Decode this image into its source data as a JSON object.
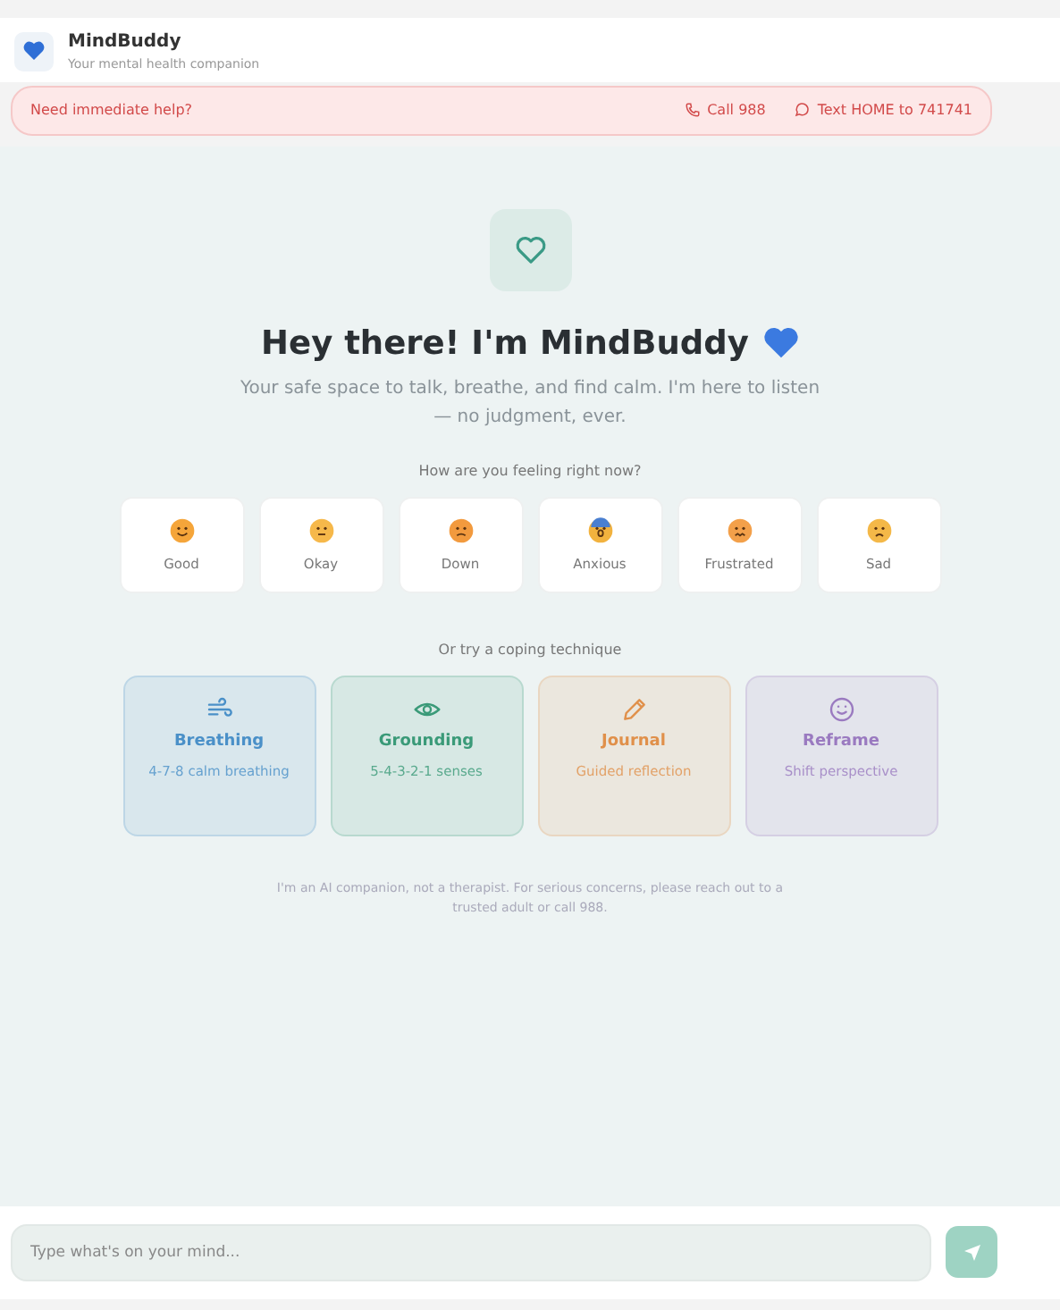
{
  "header": {
    "title": "MindBuddy",
    "subtitle": "Your mental health companion"
  },
  "crisis_bar": {
    "label": "Need immediate help?",
    "actions": [
      {
        "kind": "phone",
        "label": "Call 988"
      },
      {
        "kind": "chat",
        "label": "Text HOME to 741741"
      }
    ]
  },
  "welcome": {
    "title": "Hey there! I'm MindBuddy",
    "subtitle": "Your safe space to talk, breathe, and find calm. I'm here to listen — no judgment, ever."
  },
  "moods": {
    "prompt": "How are you feeling right now?",
    "items": [
      {
        "kind": "good",
        "label": "Good"
      },
      {
        "kind": "okay",
        "label": "Okay"
      },
      {
        "kind": "down",
        "label": "Down"
      },
      {
        "kind": "anxious",
        "label": "Anxious"
      },
      {
        "kind": "frustrated",
        "label": "Frustrated"
      },
      {
        "kind": "sad",
        "label": "Sad"
      }
    ]
  },
  "coping": {
    "prompt": "Or try a coping technique",
    "items": [
      {
        "kind": "wind",
        "title": "Breathing",
        "subtitle": "4-7-8 calm breathing",
        "color": "#4a90c8"
      },
      {
        "kind": "eye",
        "title": "Grounding",
        "subtitle": "5-4-3-2-1 senses",
        "color": "#3a9a78"
      },
      {
        "kind": "pencil",
        "title": "Journal",
        "subtitle": "Guided reflection",
        "color": "#e0904a"
      },
      {
        "kind": "smile",
        "title": "Reframe",
        "subtitle": "Shift perspective",
        "color": "#9a7ac0"
      }
    ]
  },
  "disclaimer": "I'm an AI companion, not a therapist. For serious concerns, please reach out to a trusted adult or call 988.",
  "composer": {
    "placeholder": "Type what's on your mind..."
  }
}
